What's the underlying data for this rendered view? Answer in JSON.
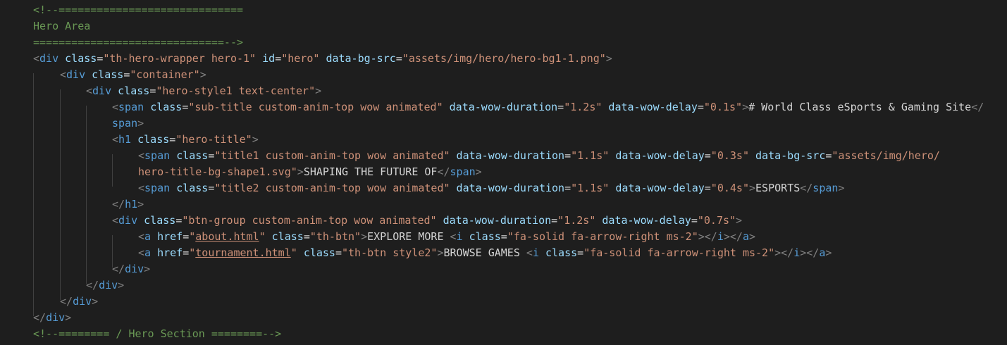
{
  "editor": {
    "language": "html",
    "theme_colors": {
      "background": "#1e1e1e",
      "comment": "#6a9955",
      "tag": "#569cd6",
      "punctuation": "#808080",
      "attribute": "#9cdcfe",
      "string": "#ce9178",
      "text": "#d4d4d4"
    },
    "lines": [
      {
        "tokens": [
          {
            "k": "c",
            "t": "<!--============================="
          }
        ]
      },
      {
        "tokens": [
          {
            "k": "c",
            "t": "Hero Area"
          }
        ]
      },
      {
        "tokens": [
          {
            "k": "c",
            "t": "==============================-->"
          }
        ]
      },
      {
        "tokens": [
          {
            "k": "p",
            "t": "<"
          },
          {
            "k": "t",
            "t": "div"
          },
          {
            "k": "x",
            "t": " "
          },
          {
            "k": "a",
            "t": "class"
          },
          {
            "k": "x",
            "t": "="
          },
          {
            "k": "s",
            "t": "\"th-hero-wrapper hero-1\""
          },
          {
            "k": "x",
            "t": " "
          },
          {
            "k": "a",
            "t": "id"
          },
          {
            "k": "x",
            "t": "="
          },
          {
            "k": "s",
            "t": "\"hero\""
          },
          {
            "k": "x",
            "t": " "
          },
          {
            "k": "a",
            "t": "data-bg-src"
          },
          {
            "k": "x",
            "t": "="
          },
          {
            "k": "s",
            "t": "\"assets/img/hero/hero-bg1-1.png\""
          },
          {
            "k": "p",
            "t": ">"
          }
        ]
      },
      {
        "tokens": [
          {
            "k": "p",
            "t": "<"
          },
          {
            "k": "t",
            "t": "div"
          },
          {
            "k": "x",
            "t": " "
          },
          {
            "k": "a",
            "t": "class"
          },
          {
            "k": "x",
            "t": "="
          },
          {
            "k": "s",
            "t": "\"container\""
          },
          {
            "k": "p",
            "t": ">"
          }
        ]
      },
      {
        "tokens": [
          {
            "k": "p",
            "t": "<"
          },
          {
            "k": "t",
            "t": "div"
          },
          {
            "k": "x",
            "t": " "
          },
          {
            "k": "a",
            "t": "class"
          },
          {
            "k": "x",
            "t": "="
          },
          {
            "k": "s",
            "t": "\"hero-style1 text-center\""
          },
          {
            "k": "p",
            "t": ">"
          }
        ]
      },
      {
        "tokens": [
          {
            "k": "p",
            "t": "<"
          },
          {
            "k": "t",
            "t": "span"
          },
          {
            "k": "x",
            "t": " "
          },
          {
            "k": "a",
            "t": "class"
          },
          {
            "k": "x",
            "t": "="
          },
          {
            "k": "s",
            "t": "\"sub-title custom-anim-top wow animated\""
          },
          {
            "k": "x",
            "t": " "
          },
          {
            "k": "a",
            "t": "data-wow-duration"
          },
          {
            "k": "x",
            "t": "="
          },
          {
            "k": "s",
            "t": "\"1.2s\""
          },
          {
            "k": "x",
            "t": " "
          },
          {
            "k": "a",
            "t": "data-wow-delay"
          },
          {
            "k": "x",
            "t": "="
          },
          {
            "k": "s",
            "t": "\"0.1s\""
          },
          {
            "k": "p",
            "t": ">"
          },
          {
            "k": "x",
            "t": "# World Class eSports & Gaming Site"
          },
          {
            "k": "p",
            "t": "</"
          }
        ]
      },
      {
        "tokens": [
          {
            "k": "t",
            "t": "span"
          },
          {
            "k": "p",
            "t": ">"
          }
        ]
      },
      {
        "tokens": [
          {
            "k": "p",
            "t": "<"
          },
          {
            "k": "t",
            "t": "h1"
          },
          {
            "k": "x",
            "t": " "
          },
          {
            "k": "a",
            "t": "class"
          },
          {
            "k": "x",
            "t": "="
          },
          {
            "k": "s",
            "t": "\"hero-title\""
          },
          {
            "k": "p",
            "t": ">"
          }
        ]
      },
      {
        "tokens": [
          {
            "k": "p",
            "t": "<"
          },
          {
            "k": "t",
            "t": "span"
          },
          {
            "k": "x",
            "t": " "
          },
          {
            "k": "a",
            "t": "class"
          },
          {
            "k": "x",
            "t": "="
          },
          {
            "k": "s",
            "t": "\"title1 custom-anim-top wow animated\""
          },
          {
            "k": "x",
            "t": " "
          },
          {
            "k": "a",
            "t": "data-wow-duration"
          },
          {
            "k": "x",
            "t": "="
          },
          {
            "k": "s",
            "t": "\"1.1s\""
          },
          {
            "k": "x",
            "t": " "
          },
          {
            "k": "a",
            "t": "data-wow-delay"
          },
          {
            "k": "x",
            "t": "="
          },
          {
            "k": "s",
            "t": "\"0.3s\""
          },
          {
            "k": "x",
            "t": " "
          },
          {
            "k": "a",
            "t": "data-bg-src"
          },
          {
            "k": "x",
            "t": "="
          },
          {
            "k": "s",
            "t": "\"assets/img/hero/"
          }
        ]
      },
      {
        "tokens": [
          {
            "k": "s",
            "t": "hero-title-bg-shape1.svg\""
          },
          {
            "k": "p",
            "t": ">"
          },
          {
            "k": "x",
            "t": "SHAPING THE FUTURE OF"
          },
          {
            "k": "p",
            "t": "</"
          },
          {
            "k": "t",
            "t": "span"
          },
          {
            "k": "p",
            "t": ">"
          }
        ]
      },
      {
        "tokens": [
          {
            "k": "p",
            "t": "<"
          },
          {
            "k": "t",
            "t": "span"
          },
          {
            "k": "x",
            "t": " "
          },
          {
            "k": "a",
            "t": "class"
          },
          {
            "k": "x",
            "t": "="
          },
          {
            "k": "s",
            "t": "\"title2 custom-anim-top wow animated\""
          },
          {
            "k": "x",
            "t": " "
          },
          {
            "k": "a",
            "t": "data-wow-duration"
          },
          {
            "k": "x",
            "t": "="
          },
          {
            "k": "s",
            "t": "\"1.1s\""
          },
          {
            "k": "x",
            "t": " "
          },
          {
            "k": "a",
            "t": "data-wow-delay"
          },
          {
            "k": "x",
            "t": "="
          },
          {
            "k": "s",
            "t": "\"0.4s\""
          },
          {
            "k": "p",
            "t": ">"
          },
          {
            "k": "x",
            "t": "ESPORTS"
          },
          {
            "k": "p",
            "t": "</"
          },
          {
            "k": "t",
            "t": "span"
          },
          {
            "k": "p",
            "t": ">"
          }
        ]
      },
      {
        "tokens": [
          {
            "k": "p",
            "t": "</"
          },
          {
            "k": "t",
            "t": "h1"
          },
          {
            "k": "p",
            "t": ">"
          }
        ]
      },
      {
        "tokens": [
          {
            "k": "p",
            "t": "<"
          },
          {
            "k": "t",
            "t": "div"
          },
          {
            "k": "x",
            "t": " "
          },
          {
            "k": "a",
            "t": "class"
          },
          {
            "k": "x",
            "t": "="
          },
          {
            "k": "s",
            "t": "\"btn-group custom-anim-top wow animated\""
          },
          {
            "k": "x",
            "t": " "
          },
          {
            "k": "a",
            "t": "data-wow-duration"
          },
          {
            "k": "x",
            "t": "="
          },
          {
            "k": "s",
            "t": "\"1.2s\""
          },
          {
            "k": "x",
            "t": " "
          },
          {
            "k": "a",
            "t": "data-wow-delay"
          },
          {
            "k": "x",
            "t": "="
          },
          {
            "k": "s",
            "t": "\"0.7s\""
          },
          {
            "k": "p",
            "t": ">"
          }
        ]
      },
      {
        "tokens": [
          {
            "k": "p",
            "t": "<"
          },
          {
            "k": "t",
            "t": "a"
          },
          {
            "k": "x",
            "t": " "
          },
          {
            "k": "a",
            "t": "href"
          },
          {
            "k": "x",
            "t": "="
          },
          {
            "k": "s",
            "t": "\""
          },
          {
            "k": "su",
            "t": "about.html"
          },
          {
            "k": "s",
            "t": "\""
          },
          {
            "k": "x",
            "t": " "
          },
          {
            "k": "a",
            "t": "class"
          },
          {
            "k": "x",
            "t": "="
          },
          {
            "k": "s",
            "t": "\"th-btn\""
          },
          {
            "k": "p",
            "t": ">"
          },
          {
            "k": "x",
            "t": "EXPLORE MORE "
          },
          {
            "k": "p",
            "t": "<"
          },
          {
            "k": "t",
            "t": "i"
          },
          {
            "k": "x",
            "t": " "
          },
          {
            "k": "a",
            "t": "class"
          },
          {
            "k": "x",
            "t": "="
          },
          {
            "k": "s",
            "t": "\"fa-solid fa-arrow-right ms-2\""
          },
          {
            "k": "p",
            "t": "></"
          },
          {
            "k": "t",
            "t": "i"
          },
          {
            "k": "p",
            "t": "></"
          },
          {
            "k": "t",
            "t": "a"
          },
          {
            "k": "p",
            "t": ">"
          }
        ]
      },
      {
        "tokens": [
          {
            "k": "p",
            "t": "<"
          },
          {
            "k": "t",
            "t": "a"
          },
          {
            "k": "x",
            "t": " "
          },
          {
            "k": "a",
            "t": "href"
          },
          {
            "k": "x",
            "t": "="
          },
          {
            "k": "s",
            "t": "\""
          },
          {
            "k": "su",
            "t": "tournament.html"
          },
          {
            "k": "s",
            "t": "\""
          },
          {
            "k": "x",
            "t": " "
          },
          {
            "k": "a",
            "t": "class"
          },
          {
            "k": "x",
            "t": "="
          },
          {
            "k": "s",
            "t": "\"th-btn style2\""
          },
          {
            "k": "p",
            "t": ">"
          },
          {
            "k": "x",
            "t": "BROWSE GAMES "
          },
          {
            "k": "p",
            "t": "<"
          },
          {
            "k": "t",
            "t": "i"
          },
          {
            "k": "x",
            "t": " "
          },
          {
            "k": "a",
            "t": "class"
          },
          {
            "k": "x",
            "t": "="
          },
          {
            "k": "s",
            "t": "\"fa-solid fa-arrow-right ms-2\""
          },
          {
            "k": "p",
            "t": "></"
          },
          {
            "k": "t",
            "t": "i"
          },
          {
            "k": "p",
            "t": "></"
          },
          {
            "k": "t",
            "t": "a"
          },
          {
            "k": "p",
            "t": ">"
          }
        ]
      },
      {
        "tokens": [
          {
            "k": "p",
            "t": "</"
          },
          {
            "k": "t",
            "t": "div"
          },
          {
            "k": "p",
            "t": ">"
          }
        ]
      },
      {
        "tokens": [
          {
            "k": "p",
            "t": "</"
          },
          {
            "k": "t",
            "t": "div"
          },
          {
            "k": "p",
            "t": ">"
          }
        ]
      },
      {
        "tokens": [
          {
            "k": "p",
            "t": "</"
          },
          {
            "k": "t",
            "t": "div"
          },
          {
            "k": "p",
            "t": ">"
          }
        ]
      },
      {
        "tokens": [
          {
            "k": "p",
            "t": "</"
          },
          {
            "k": "t",
            "t": "div"
          },
          {
            "k": "p",
            "t": ">"
          }
        ]
      },
      {
        "tokens": [
          {
            "k": "c",
            "t": "<!--======== / Hero Section ========-->"
          }
        ]
      }
    ]
  }
}
